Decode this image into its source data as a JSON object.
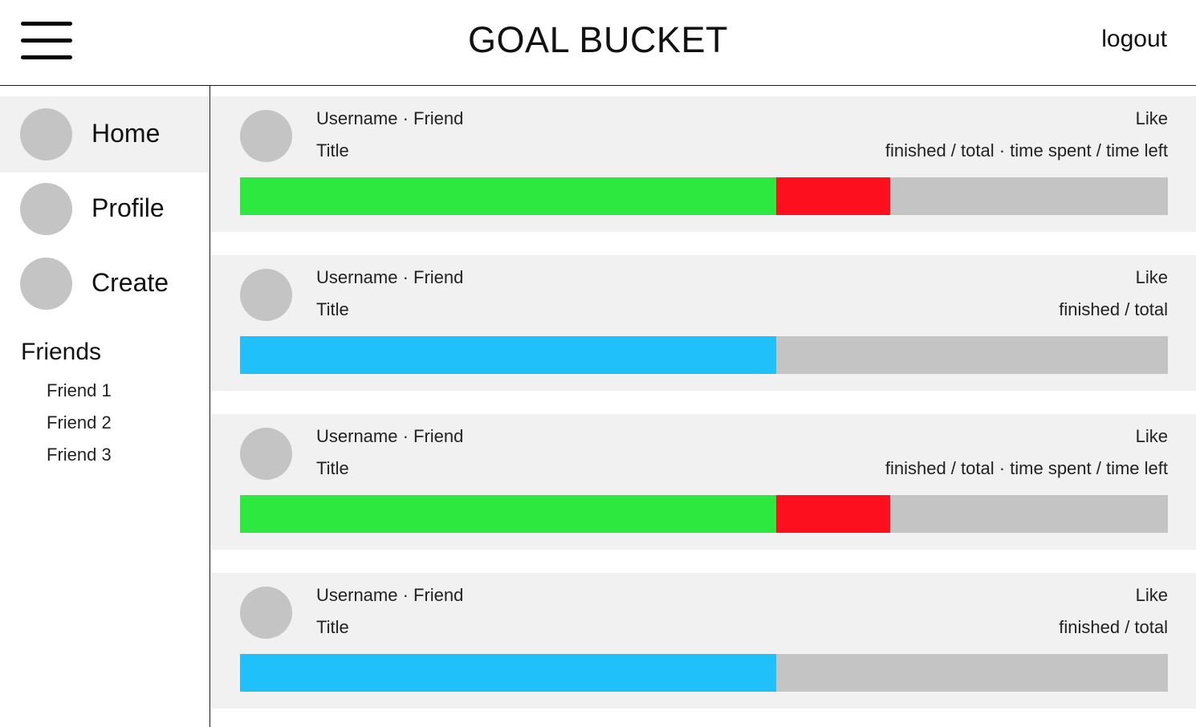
{
  "header": {
    "title": "GOAL BUCKET",
    "logout_label": "logout",
    "menu_icon": "hamburger-menu-icon"
  },
  "sidebar": {
    "nav": [
      {
        "label": "Home",
        "active": true
      },
      {
        "label": "Profile",
        "active": false
      },
      {
        "label": "Create",
        "active": false
      }
    ],
    "friends_heading": "Friends",
    "friends": [
      "Friend 1",
      "Friend 2",
      "Friend 3"
    ]
  },
  "colors": {
    "progress_finished": "#2de83f",
    "progress_overdue": "#fe0f1e",
    "progress_standard": "#20c1fa",
    "progress_track": "#c4c4c4",
    "card_background": "#f1f1f1"
  },
  "feed": [
    {
      "user": "Username · Friend",
      "title": "Title",
      "like_label": "Like",
      "stats": "finished / total · time spent / time left",
      "segments": [
        {
          "color": "#2de83f",
          "fraction": 0.578
        },
        {
          "color": "#fe0f1e",
          "fraction": 0.123
        }
      ]
    },
    {
      "user": "Username · Friend",
      "title": "Title",
      "like_label": "Like",
      "stats": "finished / total",
      "segments": [
        {
          "color": "#20c1fa",
          "fraction": 0.578
        }
      ]
    },
    {
      "user": "Username · Friend",
      "title": "Title",
      "like_label": "Like",
      "stats": "finished / total · time spent / time left",
      "segments": [
        {
          "color": "#2de83f",
          "fraction": 0.578
        },
        {
          "color": "#fe0f1e",
          "fraction": 0.123
        }
      ]
    },
    {
      "user": "Username · Friend",
      "title": "Title",
      "like_label": "Like",
      "stats": "finished / total",
      "segments": [
        {
          "color": "#20c1fa",
          "fraction": 0.578
        }
      ]
    }
  ]
}
